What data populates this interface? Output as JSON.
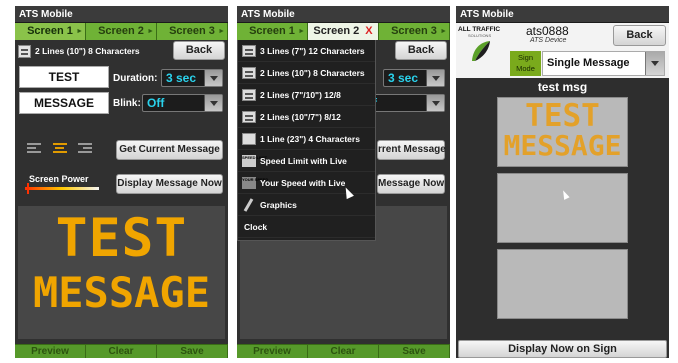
{
  "p1": {
    "app_title": "ATS Mobile",
    "tabs": [
      "Screen 1",
      "Screen 2",
      "Screen 3"
    ],
    "line_mode": "2 Lines (10\") 8 Characters",
    "back": "Back",
    "line1": "TEST",
    "line2": "MESSAGE",
    "duration_label": "Duration:",
    "duration_value": "3 sec",
    "blink_label": "Blink:",
    "blink_value": "Off",
    "get_current": "Get Current Message",
    "screen_power": "Screen Power",
    "display_now": "Display Message Now",
    "preview_line1": "TEST",
    "preview_line2": "MESSAGE",
    "bottom": [
      "Preview",
      "Clear",
      "Save"
    ]
  },
  "p2": {
    "app_title": "ATS Mobile",
    "tabs": [
      "Screen 1",
      "Screen 2",
      "Screen 3"
    ],
    "close": "X",
    "back": "Back",
    "duration_value": "3 sec",
    "blink_value": "ff",
    "get_current_partial": "rrent Message",
    "display_partial": "Message Now",
    "menu": [
      "3 Lines (7\") 12 Characters",
      "2 Lines (10\") 8 Characters",
      "2 Lines (7\"/10\") 12/8",
      "2 Lines (10\"/7\") 8/12",
      "1 Line (23\") 4 Characters",
      "Speed Limit with Live",
      "Your Speed with Live",
      "Graphics",
      "Clock"
    ],
    "speed_icon_text": "SPEED LIMIT",
    "your_speed_icon_text": "YOUR SPEED",
    "bottom": [
      "Preview",
      "Clear",
      "Save"
    ]
  },
  "p3": {
    "app_title": "ATS Mobile",
    "logo_line1": "ALL TRAFFIC",
    "logo_line2": "SOLUTIONS",
    "device_name": "ats0888",
    "device_type": "ATS Device",
    "back": "Back",
    "sign_mode": "Sign Mode",
    "message_type": "Single Message",
    "message_name": "test msg",
    "sign_line1": "TEST",
    "sign_line2": "MESSAGE",
    "display_now": "Display Now on Sign"
  },
  "colors": {
    "green": "#5aa028",
    "accent": "#2ad2ec",
    "led": "#f0a500"
  }
}
